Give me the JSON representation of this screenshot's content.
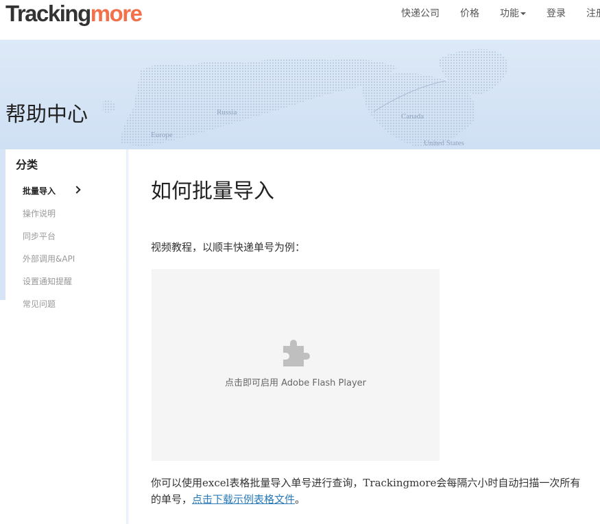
{
  "brand": {
    "part1": "Tracking",
    "part2": "more"
  },
  "nav": [
    {
      "label": "快递公司"
    },
    {
      "label": "价格"
    },
    {
      "label": "功能"
    },
    {
      "label": "登录"
    },
    {
      "label": "注册"
    }
  ],
  "banner": {
    "title": "帮助中心",
    "map_labels": [
      "Russia",
      "Europe",
      "Canada",
      "United States"
    ]
  },
  "sidebar": {
    "category_title": "分类",
    "items": [
      {
        "label": "批量导入",
        "active": true
      },
      {
        "label": "操作说明"
      },
      {
        "label": "同步平台"
      },
      {
        "label": "外部调用&API"
      },
      {
        "label": "设置通知提醒"
      },
      {
        "label": "常见问题"
      }
    ]
  },
  "main": {
    "title": "如何批量导入",
    "intro": "视频教程，以顺丰快递单号为例：",
    "flash_label": "点击即可启用 Adobe Flash Player",
    "body_before_link": "你可以使用excel表格批量导入单号进行查询，Trackingmore会每隔六小时自动扫描一次所有的单号，",
    "link_text": "点击下载示例表格文件",
    "body_after_link": "。"
  },
  "colors": {
    "brand_orange": "#f2714a",
    "link": "#2a7ab8",
    "banner": "#d6e4f5"
  },
  "icons": {
    "flash": "puzzle-icon",
    "nav_dropdown": "caret-down-icon",
    "active_item": "chevron-right-icon"
  }
}
